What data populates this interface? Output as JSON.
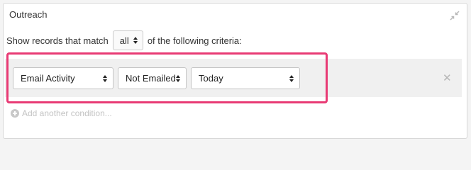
{
  "panel": {
    "title": "Outreach",
    "collapse_icon": "collapse-arrows-icon"
  },
  "match": {
    "prefix": "Show records that match",
    "selected": "all",
    "suffix": "of the following criteria:"
  },
  "condition": {
    "field": "Email Activity",
    "operator": "Not Emailed",
    "value": "Today",
    "remove_icon": "close-icon"
  },
  "add_condition": {
    "label": "Add another condition...",
    "icon": "plus-circle-icon"
  },
  "colors": {
    "highlight": "#e83a74",
    "band": "#f0f0f0"
  }
}
